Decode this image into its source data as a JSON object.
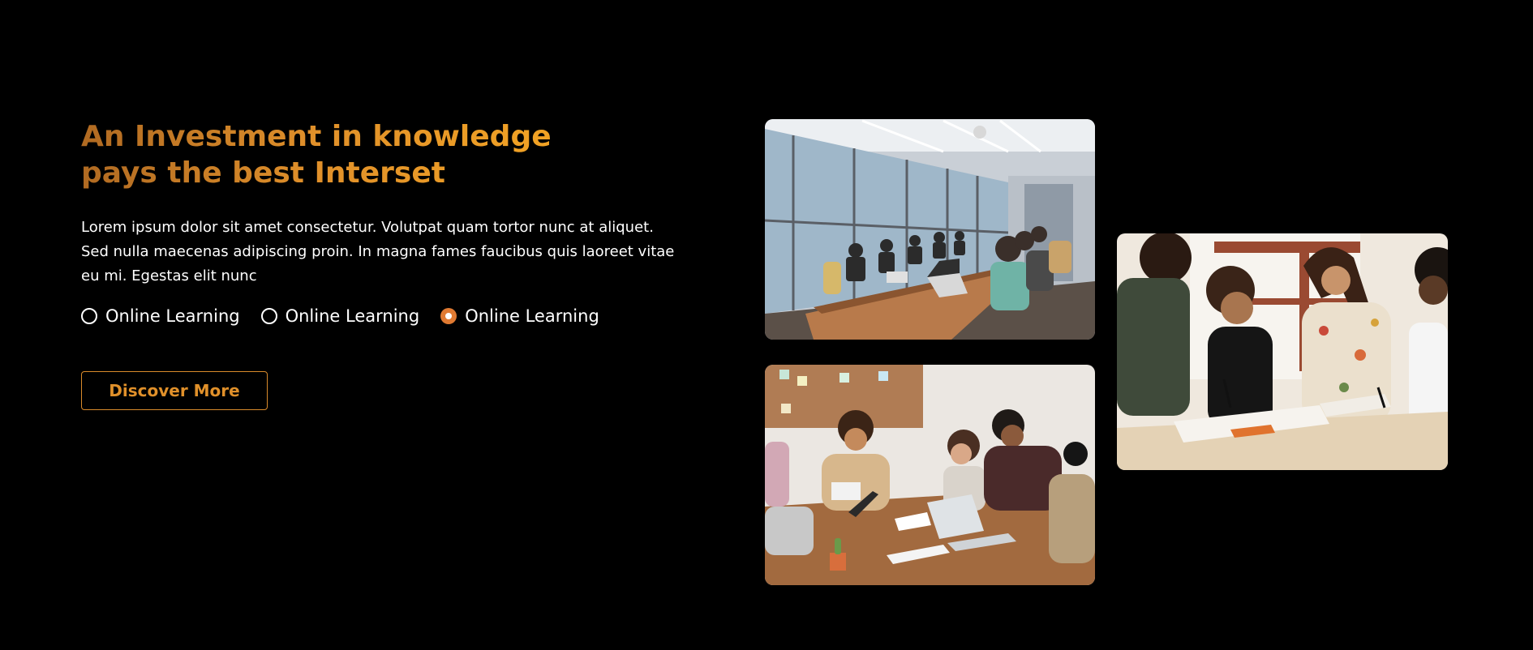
{
  "hero": {
    "headline": "An Investment in knowledge pays the best Interset",
    "description": "Lorem ipsum dolor sit amet consectetur. Volutpat quam tortor nunc at aliquet. Sed nulla maecenas adipiscing proin. In magna fames faucibus quis laoreet vitae eu mi. Egestas elit nunc",
    "options": [
      {
        "label": "Online Learning",
        "selected": false
      },
      {
        "label": "Online Learning",
        "selected": false
      },
      {
        "label": "Online Learning",
        "selected": true
      }
    ],
    "cta_label": "Discover More"
  },
  "colors": {
    "background": "#000000",
    "accent": "#e0902a",
    "radio_selected": "#e07a32"
  }
}
